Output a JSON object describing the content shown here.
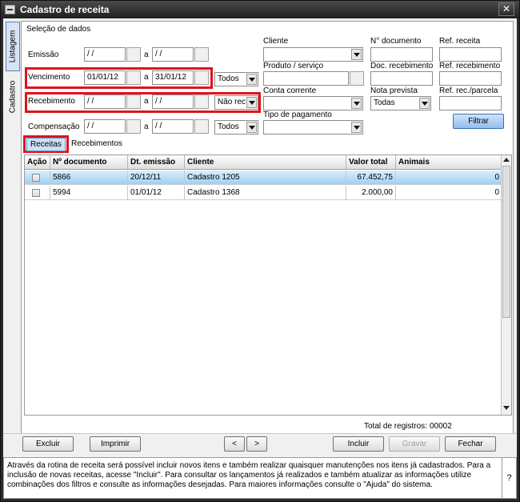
{
  "window": {
    "title": "Cadastro de receita",
    "close_glyph": "✕"
  },
  "vertical_tabs": [
    {
      "label": "Listagem"
    },
    {
      "label": "Cadastro"
    }
  ],
  "filters": {
    "section_title": "Seleção de dados",
    "separator": "a",
    "emissao": {
      "label": "Emissão",
      "from": "/ /",
      "to": "/ /"
    },
    "vencimento": {
      "label": "Vencimento",
      "from": "01/01/12",
      "to": "31/01/12",
      "combo": "Todos"
    },
    "recebimento": {
      "label": "Recebimento",
      "from": "/ /",
      "to": "/ /",
      "combo": "Não rec"
    },
    "compensacao": {
      "label": "Compensação",
      "from": "/ /",
      "to": "/ /",
      "combo": "Todos"
    },
    "cliente_label": "Cliente",
    "produto_label": "Produto / serviço",
    "conta_label": "Conta corrente",
    "tipo_pagamento_label": "Tipo de pagamento",
    "n_documento_label": "N° documento",
    "doc_recebimento_label": "Doc. recebimento",
    "nota_prevista_label": "Nota prevista",
    "nota_prevista_value": "Todas",
    "ref_receita_label": "Ref. receita",
    "ref_recebimento_label": "Ref. recebimento",
    "ref_parcela_label": "Ref. rec./parcela",
    "filtrar_label": "Filtrar"
  },
  "tabs": [
    {
      "label": "Receitas"
    },
    {
      "label": "Recebimentos"
    }
  ],
  "grid": {
    "columns": [
      "Ação",
      "Nº documento",
      "Dt. emissão",
      "Cliente",
      "Valor total",
      "Animais"
    ],
    "rows": [
      {
        "doc": "5866",
        "emissao": "20/12/11",
        "cliente": "Cadastro 1205",
        "valor": "67.452,75",
        "animais": "0"
      },
      {
        "doc": "5994",
        "emissao": "01/01/12",
        "cliente": "Cadastro 1368",
        "valor": "2.000,00",
        "animais": "0"
      }
    ]
  },
  "status": {
    "total_label": "Total de registros:",
    "total_value": "00002"
  },
  "toolbar": {
    "excluir": "Excluir",
    "imprimir": "Imprimir",
    "prev": "<",
    "next": ">",
    "incluir": "Incluir",
    "gravar": "Gravar",
    "fechar": "Fechar"
  },
  "help": {
    "text": "Através da rotina de receita será possível incluir novos itens e também realizar quaisquer manutenções nos itens já cadastrados. Para a inclusão de novas receitas, acesse \"Incluir\". Para consultar os lançamentos já realizados e também atualizar as informações utilize combinações dos filtros e consulte as informações desejadas. Para maiores informações consulte o \"Ajuda\" do sistema.",
    "question": "?"
  }
}
